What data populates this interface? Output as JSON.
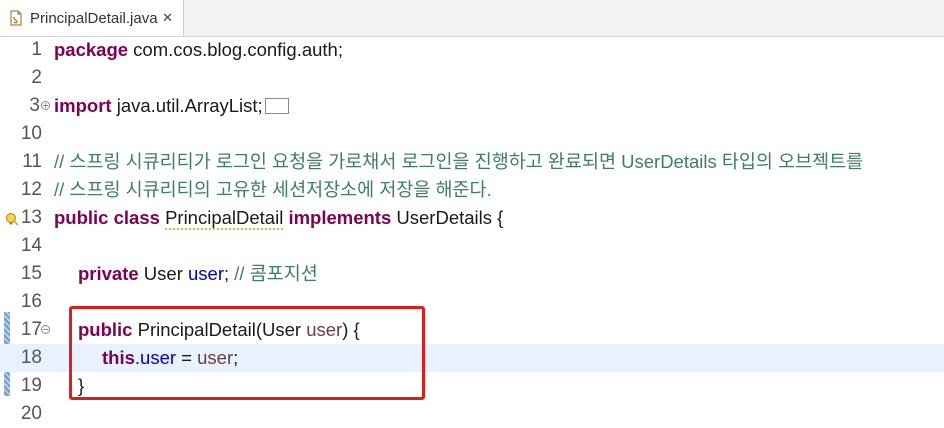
{
  "tab": {
    "label": "PrincipalDetail.java",
    "close_glyph": "✕",
    "icon": "java-file-icon"
  },
  "lines": {
    "l1": {
      "num": "1",
      "kw": "package",
      "rest": " com.cos.blog.config.auth;"
    },
    "l2": {
      "num": "2"
    },
    "l3": {
      "num": "3",
      "kw": "import",
      "rest": " java.util.ArrayList;"
    },
    "l10": {
      "num": "10"
    },
    "l11": {
      "num": "11",
      "comment": "// 스프링 시큐리티가 로그인 요청을 가로채서 로그인을 진행하고 완료되면 UserDetails 타입의 오브젝트를"
    },
    "l12": {
      "num": "12",
      "comment": "// 스프링 시큐리티의 고유한 세션저장소에 저장을 해준다."
    },
    "l13": {
      "num": "13",
      "kw1": "public",
      "kw2": "class",
      "name": "PrincipalDetail",
      "kw3": "implements",
      "rest": " UserDetails {"
    },
    "l14": {
      "num": "14"
    },
    "l15": {
      "num": "15",
      "kw": "private",
      "type": " User ",
      "field": "user",
      "rest": "; ",
      "comment": "// 콤포지션"
    },
    "l16": {
      "num": "16"
    },
    "l17": {
      "num": "17",
      "kw": "public",
      "sig": " PrincipalDetail(User ",
      "param": "user",
      "rest": ") {"
    },
    "l18": {
      "num": "18",
      "kw": "this",
      "dot": ".",
      "field": "user",
      "eq": " = ",
      "param": "user",
      "semi": ";"
    },
    "l19": {
      "num": "19",
      "rest": "}"
    },
    "l20": {
      "num": "20"
    }
  },
  "colors": {
    "keyword": "#7f0055",
    "comment": "#3f7f5f",
    "field": "#0000c0",
    "param": "#6a3e3e",
    "highlight_box": "#e21b1b",
    "current_line": "#e8f2fe"
  }
}
